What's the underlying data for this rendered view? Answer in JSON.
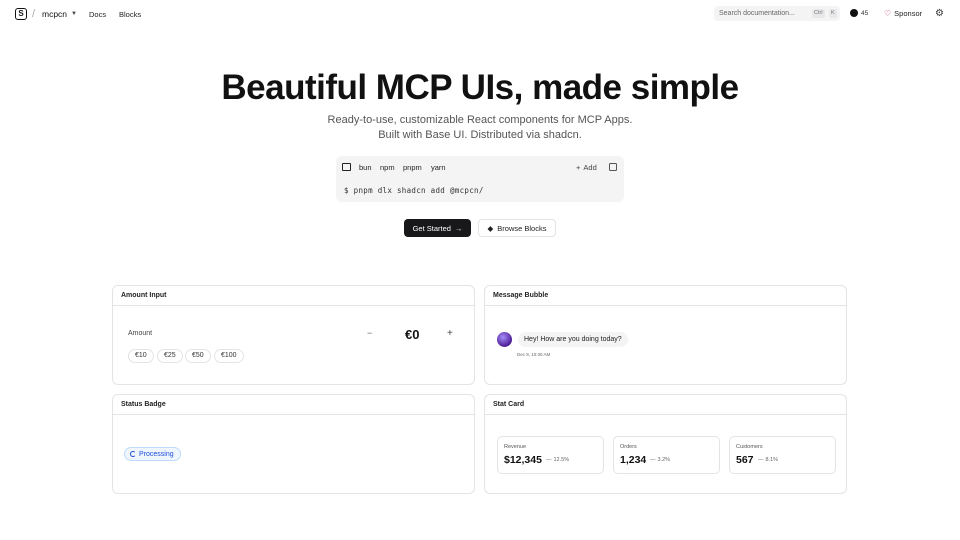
{
  "header": {
    "logo_glyph": "S",
    "brand": "mcpcn",
    "nav": [
      "Docs",
      "Blocks"
    ],
    "search_placeholder": "Search documentation...",
    "kbd": [
      "Ctrl",
      "K"
    ],
    "github_stars": "45",
    "sponsor": "Sponsor"
  },
  "hero": {
    "title": "Beautiful MCP UIs, made simple",
    "subtitle": "Ready-to-use, customizable React components for MCP Apps. Built with Base UI. Distributed via shadcn."
  },
  "install": {
    "tabs": [
      "bun",
      "npm",
      "pnpm",
      "yarn"
    ],
    "active_tab": "pnpm",
    "add_label": "Add",
    "command": "$ pnpm dlx shadcn add @mcpcn/"
  },
  "cta": {
    "primary": "Get Started",
    "secondary": "Browse Blocks"
  },
  "cards": {
    "amount_input": {
      "title": "Amount Input",
      "label": "Amount",
      "value": "€0",
      "presets": [
        "€10",
        "€25",
        "€50",
        "€100"
      ]
    },
    "message_bubble": {
      "title": "Message Bubble",
      "message": "Hey! How are you doing today?",
      "time": "Dec 8, 10:30 AM"
    },
    "status_badge": {
      "title": "Status Badge",
      "status": "Processing"
    },
    "stat_card": {
      "title": "Stat Card",
      "stats": [
        {
          "label": "Revenue",
          "value": "$12,345",
          "trend": "12.5%"
        },
        {
          "label": "Orders",
          "value": "1,234",
          "trend": "3.2%"
        },
        {
          "label": "Customers",
          "value": "567",
          "trend": "8.1%"
        }
      ]
    }
  },
  "colors": {
    "primary_button": "#18181b",
    "badge_blue": "#1d4ed8",
    "sponsor_heart": "#db2777"
  }
}
